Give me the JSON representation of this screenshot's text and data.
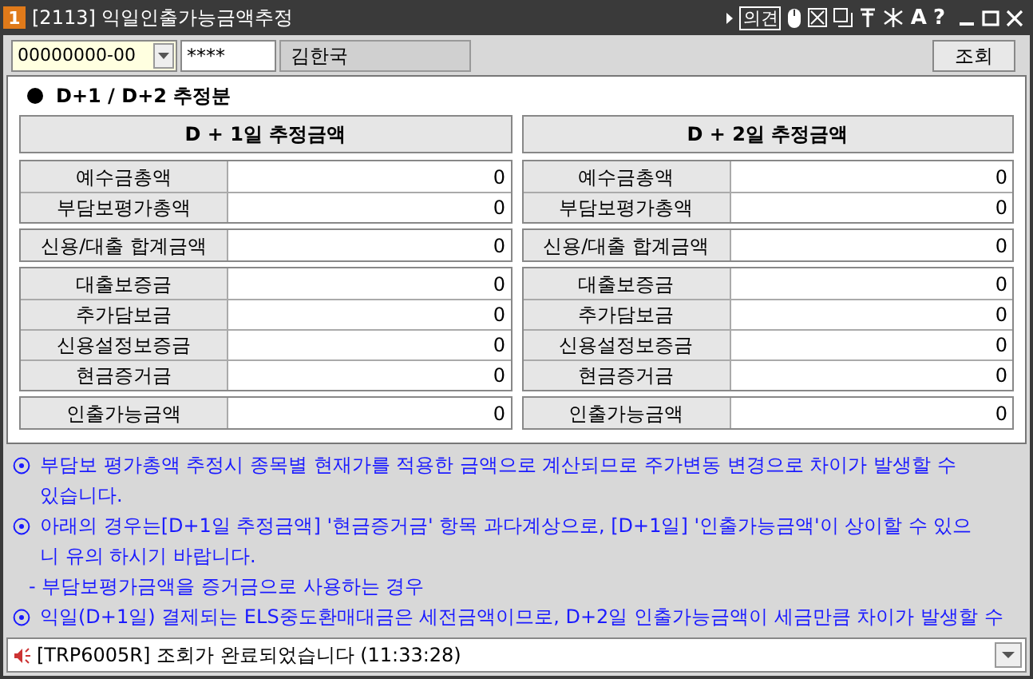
{
  "window": {
    "badge": "1",
    "title": "[2113] 익일인출가능금액추정",
    "opinion_button": "의견",
    "font_button": "A",
    "help_button": "?"
  },
  "toolbar": {
    "account": "00000000-00",
    "password": "****",
    "name": "김한국",
    "query_button": "조회"
  },
  "section_title": "D+1 / D+2 추정분",
  "panels": [
    {
      "header": "D + 1일 추정금액",
      "groups": [
        [
          {
            "label": "예수금총액",
            "value": "0"
          },
          {
            "label": "부담보평가총액",
            "value": "0"
          }
        ],
        [
          {
            "label": "신용/대출 합계금액",
            "value": "0"
          }
        ],
        [
          {
            "label": "대출보증금",
            "value": "0"
          },
          {
            "label": "추가담보금",
            "value": "0"
          },
          {
            "label": "신용설정보증금",
            "value": "0"
          },
          {
            "label": "현금증거금",
            "value": "0"
          }
        ],
        [
          {
            "label": "인출가능금액",
            "value": "0"
          }
        ]
      ]
    },
    {
      "header": "D + 2일 추정금액",
      "groups": [
        [
          {
            "label": "예수금총액",
            "value": "0"
          },
          {
            "label": "부담보평가총액",
            "value": "0"
          }
        ],
        [
          {
            "label": "신용/대출 합계금액",
            "value": "0"
          }
        ],
        [
          {
            "label": "대출보증금",
            "value": "0"
          },
          {
            "label": "추가담보금",
            "value": "0"
          },
          {
            "label": "신용설정보증금",
            "value": "0"
          },
          {
            "label": "현금증거금",
            "value": "0"
          }
        ],
        [
          {
            "label": "인출가능금액",
            "value": "0"
          }
        ]
      ]
    }
  ],
  "notes": [
    {
      "kind": "bullet",
      "lines": [
        "부담보 평가총액 추정시 종목별 현재가를 적용한 금액으로 계산되므로 주가변동 변경으로 차이가 발생할 수",
        "있습니다."
      ]
    },
    {
      "kind": "bullet",
      "lines": [
        "아래의 경우는[D+1일 추정금액] '현금증거금' 항목 과다계상으로, [D+1일] '인출가능금액'이 상이할 수 있으",
        "니 유의 하시기 바랍니다."
      ]
    },
    {
      "kind": "dash",
      "lines": [
        "- 부담보평가금액을 증거금으로 사용하는 경우"
      ]
    },
    {
      "kind": "bullet",
      "lines": [
        "익일(D+1일) 결제되는 ELS중도환매대금은 세전금액이므로, D+2일 인출가능금액이 세금만큼 차이가 발생할 수"
      ]
    }
  ],
  "status_bar": {
    "message": "[TRP6005R] 조회가 완료되었습니다 (11:33:28)"
  }
}
